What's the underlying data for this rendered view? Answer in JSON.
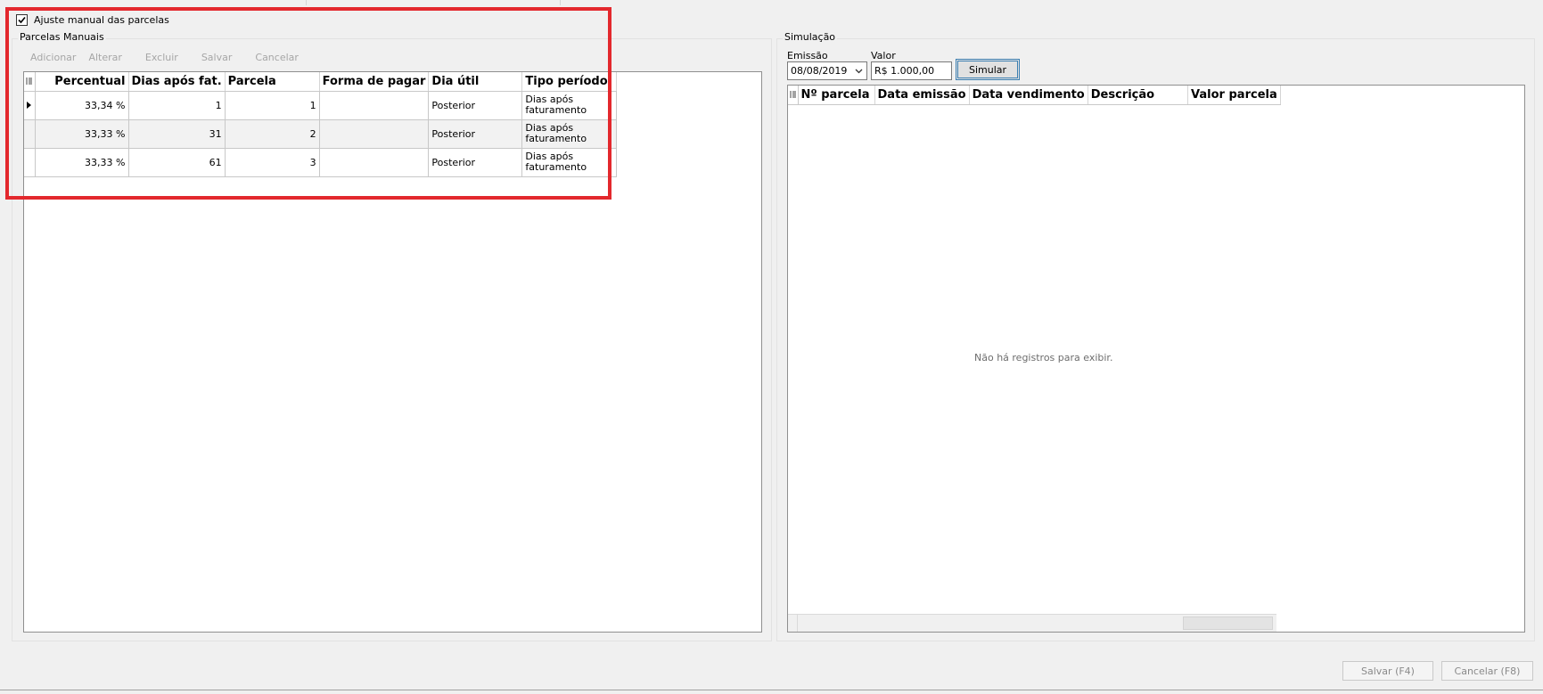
{
  "checkbox": {
    "label": "Ajuste manual das parcelas",
    "checked": true
  },
  "left_group": {
    "title": "Parcelas Manuais",
    "toolbar": [
      "Adicionar",
      "Alterar",
      "Excluir",
      "Salvar",
      "Cancelar"
    ],
    "columns": [
      "Percentual",
      "Dias após fat.",
      "Parcela",
      "Forma de pagar",
      "Dia útil",
      "Tipo período"
    ],
    "rows": [
      {
        "percentual": "33,34 %",
        "dias": "1",
        "parcela": "1",
        "forma": "",
        "dia_util": "Posterior",
        "tipo": "Dias após faturamento"
      },
      {
        "percentual": "33,33 %",
        "dias": "31",
        "parcela": "2",
        "forma": "",
        "dia_util": "Posterior",
        "tipo": "Dias após faturamento"
      },
      {
        "percentual": "33,33 %",
        "dias": "61",
        "parcela": "3",
        "forma": "",
        "dia_util": "Posterior",
        "tipo": "Dias após faturamento"
      }
    ]
  },
  "right_group": {
    "title": "Simulação",
    "emissao_label": "Emissão",
    "emissao_value": "08/08/2019",
    "valor_label": "Valor",
    "valor_value": "R$ 1.000,00",
    "simular_label": "Simular",
    "columns": [
      "Nº parcela",
      "Data emissão",
      "Data vendimento",
      "Descrição",
      "Valor parcela"
    ],
    "empty_message": "Não há registros para exibir."
  },
  "footer": {
    "salvar_label": "Salvar (F4)",
    "cancelar_label": "Cancelar (F8)"
  },
  "colors": {
    "highlight": "#e3282d",
    "background": "#f0f0f0",
    "disabled_text": "#a6a6a6"
  },
  "icons": {
    "checkbox": "check-icon",
    "grid_menu": "grid-columns-icon",
    "row_indicator": "row-pointer-icon",
    "dropdown": "chevron-down-icon"
  }
}
